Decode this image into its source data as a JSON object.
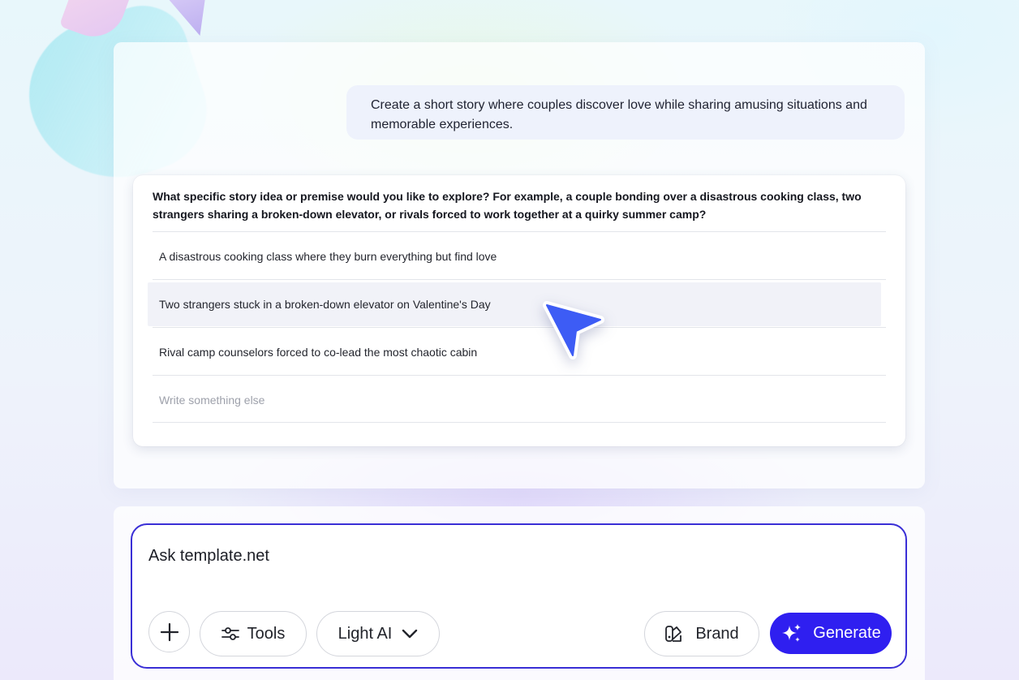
{
  "conversation": {
    "user_message": "Create a short story where couples discover love while sharing amusing situations and memorable experiences.",
    "question": {
      "text": "What specific story idea or premise would you like to explore? For example, a couple bonding over a disastrous cooking class, two strangers sharing a broken-down elevator, or rivals forced to work together at a quirky summer camp?",
      "options": [
        {
          "label": "A disastrous cooking class where they burn everything but find love"
        },
        {
          "label": "Two strangers stuck in a broken-down elevator on Valentine's Day"
        },
        {
          "label": "Rival camp counselors forced to co-lead the most chaotic cabin"
        },
        {
          "label": "Write something else"
        }
      ]
    }
  },
  "composer": {
    "placeholder": "Ask template.net",
    "value": "",
    "buttons": {
      "attach_icon": "plus-icon",
      "tools_label": "Tools",
      "tools_icon": "sliders-icon",
      "model_label": "Light AI",
      "model_icon": "chevron-down-icon",
      "brand_label": "Brand",
      "brand_icon": "swatch-icon",
      "generate_label": "Generate",
      "generate_icon": "sparkles-icon"
    }
  },
  "colors": {
    "accent": "#2f1ff0",
    "composer_border": "#3a2fd6",
    "cursor": "#3d5cf5"
  }
}
